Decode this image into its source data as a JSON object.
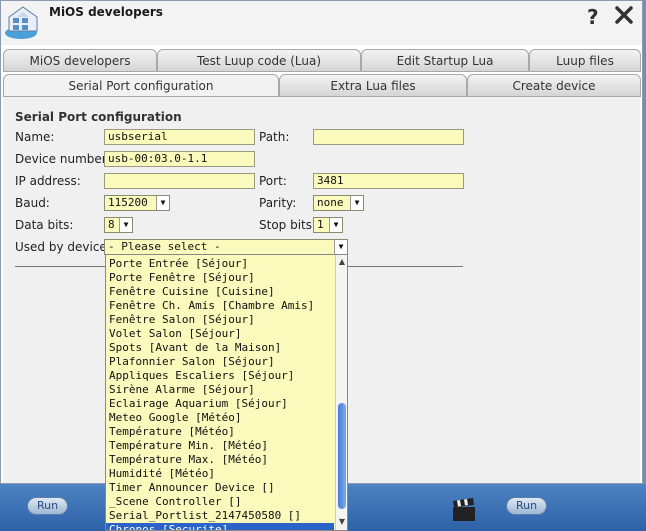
{
  "window": {
    "title": "MiOS developers"
  },
  "tabs_row1": [
    "MiOS developers",
    "Test Luup code (Lua)",
    "Edit Startup Lua",
    "Luup files"
  ],
  "tabs_row2": [
    "Serial Port configuration",
    "Extra Lua files",
    "Create device"
  ],
  "form": {
    "section_title": "Serial Port configuration",
    "name_label": "Name:",
    "name_value": "usbserial",
    "path_label": "Path:",
    "path_value": "",
    "device_number_label": "Device number:",
    "device_number_value": "usb-00:03.0-1.1",
    "ip_label": "IP address:",
    "ip_value": "",
    "port_label": "Port:",
    "port_value": "3481",
    "baud_label": "Baud:",
    "baud_value": "115200",
    "parity_label": "Parity:",
    "parity_value": "none",
    "data_bits_label": "Data bits:",
    "data_bits_value": "8",
    "stop_bits_label": "Stop bits:",
    "stop_bits_value": "1",
    "used_by_label": "Used by device:",
    "used_by_value": "- Please select -"
  },
  "dropdown_items": [
    "Porte Entrée [Séjour]",
    "Porte Fenêtre [Séjour]",
    "Fenêtre Cuisine [Cuisine]",
    "Fenêtre Ch. Amis [Chambre Amis]",
    "Fenêtre Salon [Séjour]",
    "Volet Salon [Séjour]",
    "Spots [Avant de la Maison]",
    "Plafonnier Salon [Séjour]",
    "Appliques Escaliers [Séjour]",
    "Sirène Alarme [Séjour]",
    "Eclairage Aquarium [Séjour]",
    "Meteo Google [Météo]",
    "Température [Météo]",
    "Température Min. [Météo]",
    "Température Max. [Météo]",
    "Humidité [Météo]",
    "Timer Announcer Device []",
    "_Scene Controller []",
    "Serial_Portlist_2147450580 []",
    "Chronos [Securite]"
  ],
  "selected_index": 19,
  "bottom": {
    "run_label": "Run"
  },
  "colors": {
    "field_bg": "#fafabd",
    "selected_bg": "#2b64c9"
  }
}
